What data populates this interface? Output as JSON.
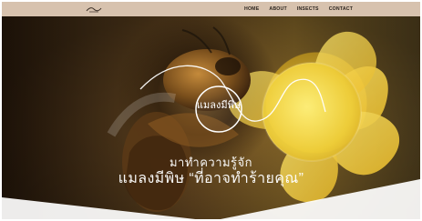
{
  "header": {
    "nav": [
      "HOME",
      "ABOUT",
      "INSECTS",
      "CONTACT"
    ]
  },
  "hero": {
    "logo_text": "แมลงมีพิษ",
    "kicker": "มาทำความรู้จัก",
    "title": "แมลงมีพิษ “ที่อาจทำร้ายคุณ”"
  },
  "colors": {
    "topbar": "#d7c2ae",
    "hero_text": "#ffffff"
  }
}
